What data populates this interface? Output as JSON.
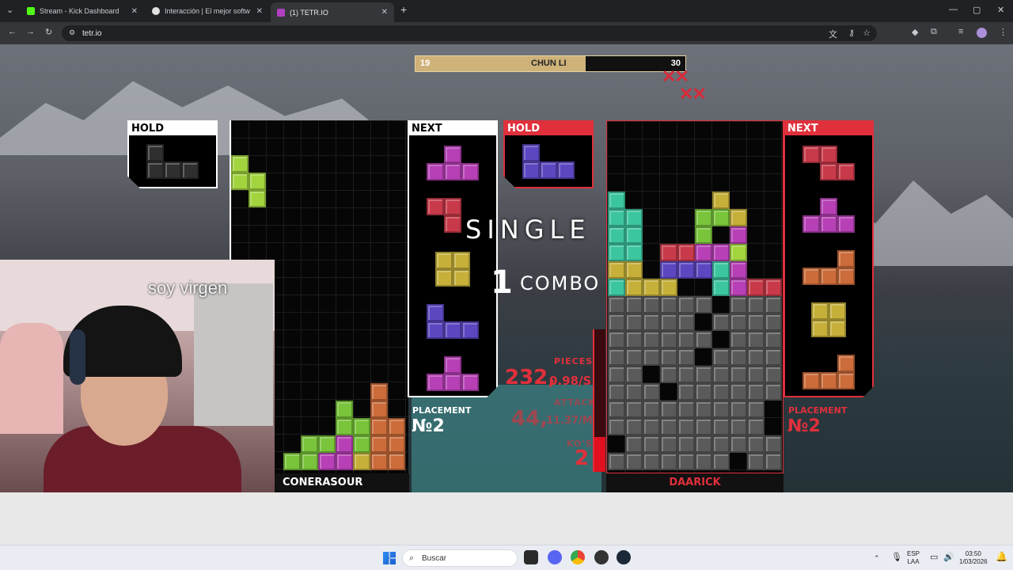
{
  "tabs": [
    {
      "title": "Stream - Kick Dashboard",
      "color": "#53fc18"
    },
    {
      "title": "Interacción | El mejor softw",
      "color": "#e0e0e0"
    },
    {
      "title": "(1) TETR.IO",
      "color": "#b040c0"
    }
  ],
  "address": "tetr.io",
  "game": {
    "versus": {
      "left_score": "19",
      "name": "CHUN LI",
      "right_score": "30",
      "progress": 0.63
    },
    "left": {
      "hold_label": "HOLD",
      "next_label": "NEXT",
      "player": "CONERASOUR",
      "placement_label": "PLACEMENT",
      "placement": "№2"
    },
    "right": {
      "hold_label": "HOLD",
      "next_label": "NEXT",
      "player": "DAARICK",
      "placement_label": "PLACEMENT",
      "placement": "№2",
      "pieces_label": "PIECES",
      "pieces": "232,",
      "pps": "0.98/S",
      "attack_label": "ATTACK",
      "attack": "44,",
      "apm": "11.37/M",
      "kos_label": "KO'S",
      "kos": "2"
    },
    "action_text": "SINGLE",
    "combo_num": "1",
    "combo_label": "COMBO"
  },
  "stream_overlay": "soy virgen",
  "taskbar": {
    "search_placeholder": "Buscar",
    "lang_top": "ESP",
    "lang_bottom": "LAA",
    "time": "03:50",
    "date": "1/03/2026"
  }
}
